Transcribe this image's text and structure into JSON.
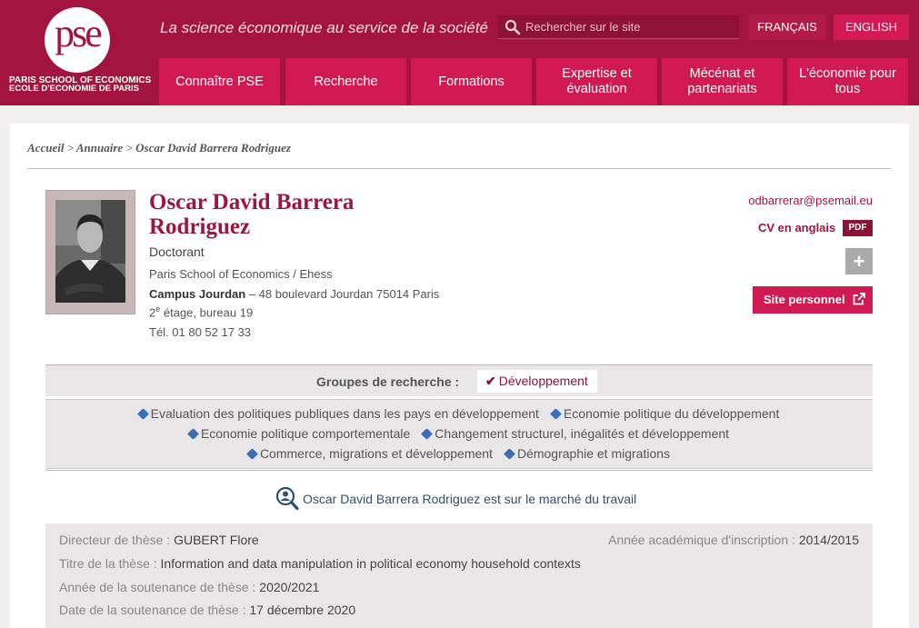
{
  "header": {
    "logo_mark": "pse",
    "logo_line1": "PARIS SCHOOL OF ECONOMICS",
    "logo_line2": "ECOLE D'ECONOMIE DE PARIS",
    "tagline": "La science économique au service de la société",
    "search_placeholder": "Rechercher sur le site",
    "lang_fr": "FRANÇAIS",
    "lang_en": "ENGLISH",
    "nav": [
      "Connaître PSE",
      "Recherche",
      "Formations",
      "Expertise et évaluation",
      "Mécénat et partenariats",
      "L'économie pour tous"
    ]
  },
  "breadcrumb": {
    "home": "Accueil",
    "sep": ">",
    "directory": "Annuaire",
    "current": "Oscar David Barrera Rodriguez"
  },
  "profile": {
    "name_line1": "Oscar David Barrera",
    "name_line2": "Rodriguez",
    "role": "Doctorant",
    "institution": "Paris School of Economics / Ehess",
    "campus": "Campus Jourdan",
    "address": " – 48 boulevard Jourdan 75014 Paris",
    "floor_num": "2",
    "floor_sup": "e",
    "floor_rest": " étage, bureau 19",
    "tel": "Tél. 01 80 52 17 33",
    "email": "odbarrerar@psemail.eu",
    "cv_label": "CV en anglais",
    "pdf_label": "PDF",
    "plus_label": "+",
    "site_label": "Site personnel"
  },
  "groups": {
    "label": "Groupes de recherche :",
    "tag": "Développement"
  },
  "tags": {
    "row1": [
      "Evaluation des politiques publiques dans les pays en développement",
      "Economie politique du développement"
    ],
    "row2": [
      "Economie politique comportementale",
      "Changement structurel, inégalités et développement"
    ],
    "row3": [
      "Commerce, migrations et développement",
      "Démographie et migrations"
    ]
  },
  "job_market": "Oscar David Barrera Rodriguez est sur le marché du travail",
  "thesis": {
    "director_label": "Directeur de thèse : ",
    "director": "GUBERT Flore",
    "year_label": "Année académique d'inscription : ",
    "year": "2014/2015",
    "title_label": "Titre de la thèse : ",
    "title": "Information and data manipulation in political economy household contexts",
    "defense_year_label": "Année de la soutenance de thèse : ",
    "defense_year": "2020/2021",
    "defense_date_label": "Date de la soutenance de thèse : ",
    "defense_date": "17 décembre 2020"
  },
  "colors": {
    "brand": "#a3153f",
    "nav": "#d01a51",
    "tag_icon": "#3d6eb4"
  }
}
